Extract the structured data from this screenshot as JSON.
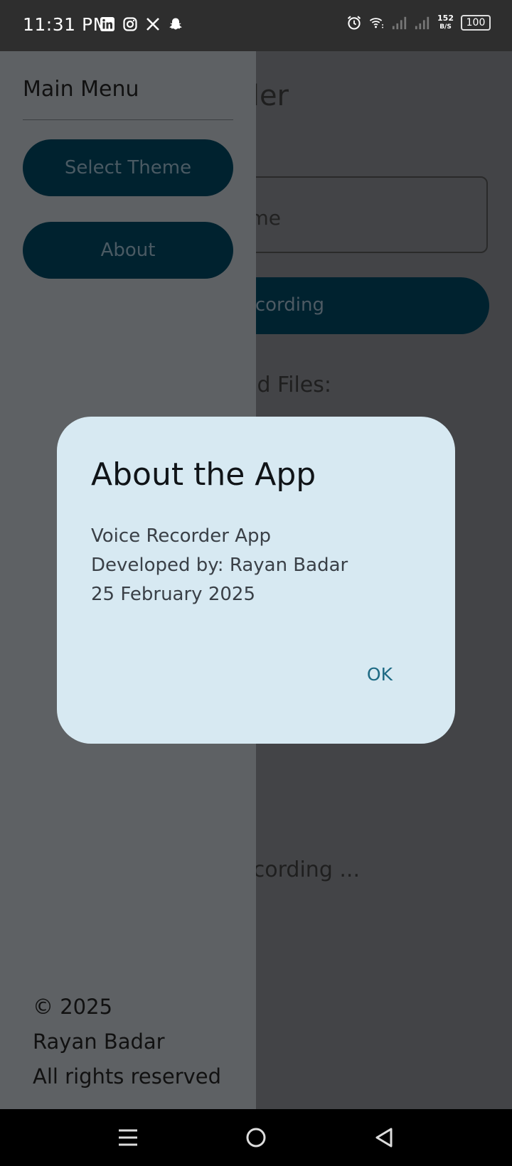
{
  "status_bar": {
    "time": "11:31 PM",
    "left_icons": [
      "linkedin-icon",
      "instagram-icon",
      "x-icon",
      "snapchat-icon"
    ],
    "right_icons": [
      "alarm-icon",
      "wifi-icon",
      "signal-icon",
      "signal-icon"
    ],
    "net_speed_value": "152",
    "net_speed_unit": "B/S",
    "battery": "100"
  },
  "background_app": {
    "title_fragment": "der",
    "input_fragment": "me",
    "record_button_fragment": "cording",
    "saved_files_fragment": "ed Files:",
    "status_fragment": "cording ..."
  },
  "drawer": {
    "title": "Main Menu",
    "items": [
      {
        "label": "Select Theme"
      },
      {
        "label": "About"
      }
    ],
    "footer": {
      "line1": "© 2025",
      "line2": "Rayan Badar",
      "line3": "All rights reserved"
    }
  },
  "dialog": {
    "title": "About the App",
    "line1": "Voice Recorder App",
    "line2": "Developed by: Rayan Badar",
    "line3": "25 February 2025",
    "ok_label": "OK"
  },
  "nav_bar": {
    "icons": [
      "recents-icon",
      "home-icon",
      "back-icon"
    ]
  },
  "colors": {
    "accent_button": "#00222f",
    "dialog_bg": "#d7e9f2",
    "ok_text": "#1e6a84",
    "drawer_bg": "#5e6164"
  }
}
